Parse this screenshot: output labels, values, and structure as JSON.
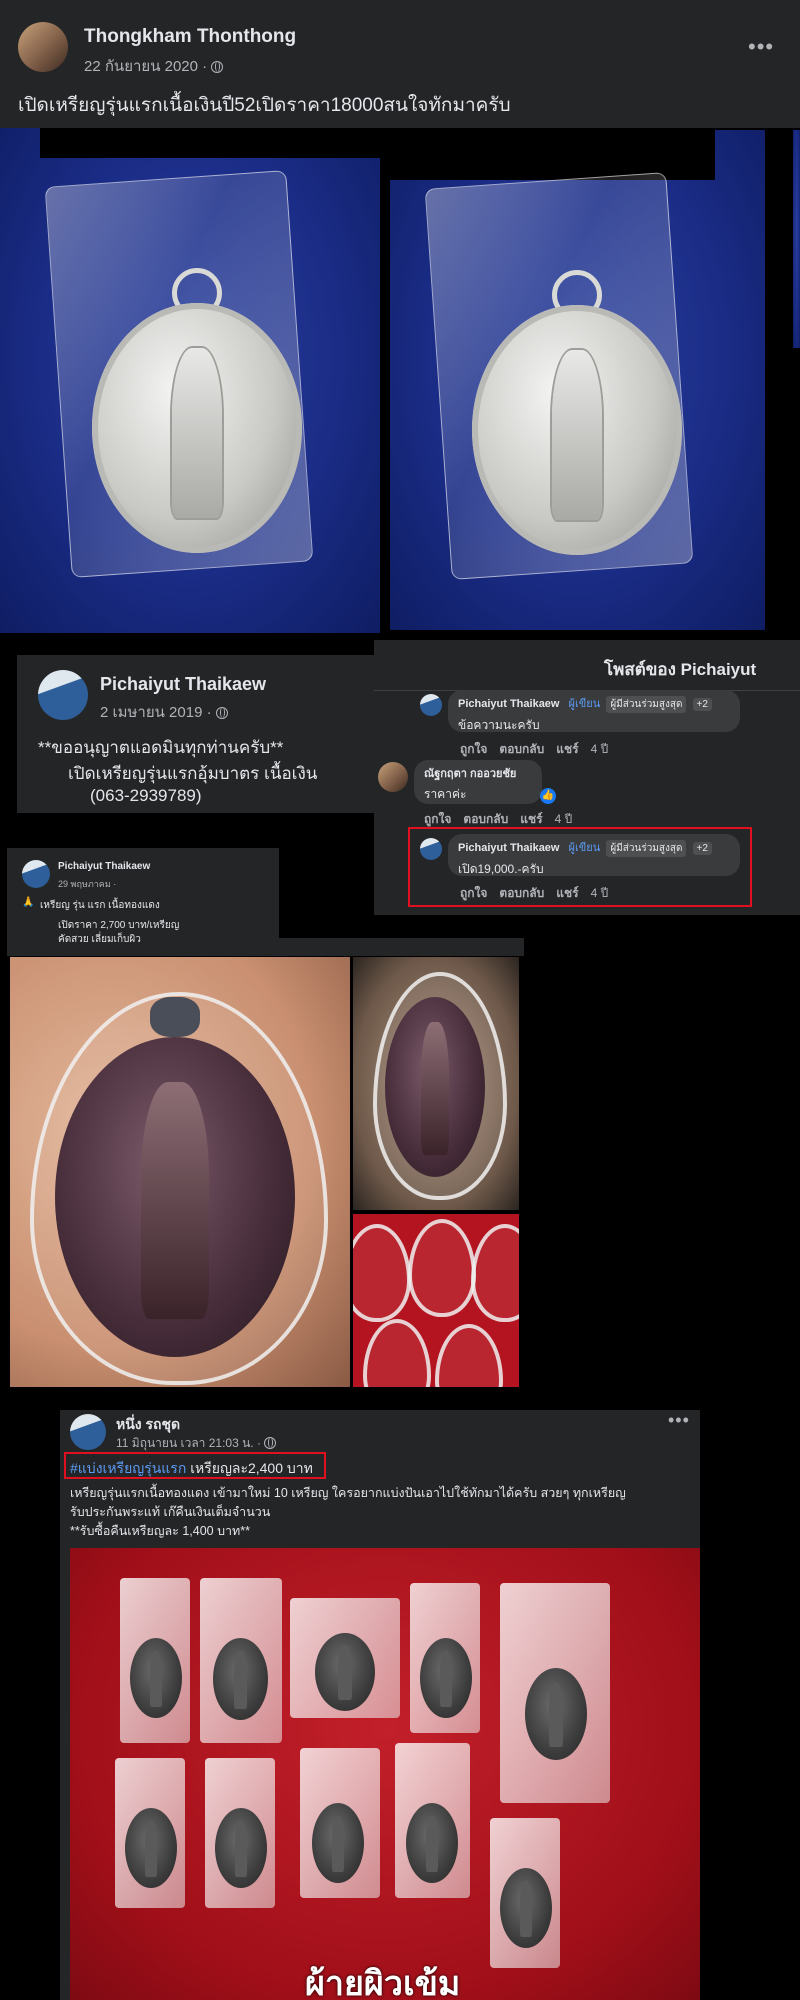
{
  "post1": {
    "author": "Thongkham Thonthong",
    "date": "22 กันยายน 2020 ·",
    "text": "เปิดเหรียญรุ่นแรกเนื้อเงินปี52เปิดราคา18000สนใจทักมาครับ",
    "more": "•••"
  },
  "post2": {
    "author": "Pichaiyut Thaikaew",
    "date": "2 เมษายน 2019 ·",
    "line1": "**ขออนุญาตแอดมินทุกท่านครับ**",
    "line2": "เปิดเหรียญรุ่นแรกอุ้มบาตร  เนื้อเงิน",
    "line3": "(063-2939789)"
  },
  "comments_panel": {
    "title": "โพสต์ของ Pichaiyut",
    "comments": [
      {
        "author": "Pichaiyut Thaikaew",
        "badge1": "ผู้เขียน",
        "badge2": "ผู้มีส่วนร่วมสูงสุด",
        "badge3": "+2",
        "text": "ข้อความนะครับ",
        "like": "ถูกใจ",
        "reply": "ตอบกลับ",
        "share": "แชร์",
        "age": "4 ปี"
      },
      {
        "author": "ณัฐกฤตา กออวยชัย",
        "text": "ราคาค่ะ",
        "like": "ถูกใจ",
        "reply": "ตอบกลับ",
        "share": "แชร์",
        "age": "4 ปี"
      },
      {
        "author": "Pichaiyut Thaikaew",
        "badge1": "ผู้เขียน",
        "badge2": "ผู้มีส่วนร่วมสูงสุด",
        "badge3": "+2",
        "text": "เปิด19,000.-ครับ",
        "like": "ถูกใจ",
        "reply": "ตอบกลับ",
        "share": "แชร์",
        "age": "4 ปี"
      }
    ]
  },
  "post3": {
    "author": "Pichaiyut Thaikaew",
    "date": "29 พฤษภาคม ·",
    "line1": "เหรียญ รุ่น แรก เนื้อทองแดง",
    "line2": "เปิดราคา  2,700  บาท/เหรียญ",
    "line3": "คัดสวย เลี่ยมเก็บผิว"
  },
  "post4": {
    "author": "หนึ่ง รถชุด",
    "date": "11 มิถุนายน เวลา 21:03 น. ·",
    "hashtag": "#แบ่งเหรียญรุ่นแรก",
    "price": " เหรียญละ2,400 บาท",
    "body1": "เหรียญรุ่นแรกเนื้อทองแดง เข้ามาใหม่ 10 เหรียญ ใครอยากแบ่งปันเอาไปใช้ทักมาได้ครับ สวยๆ ทุกเหรียญ",
    "body2": "รับประกันพระแท้ เก๊คืนเงินเต็มจำนวน",
    "body3": "**รับซื้อคืนเหรียญละ 1,400 บาท**",
    "photo_caption": "ผ้ายผิวเข้ม",
    "more": "•••"
  }
}
